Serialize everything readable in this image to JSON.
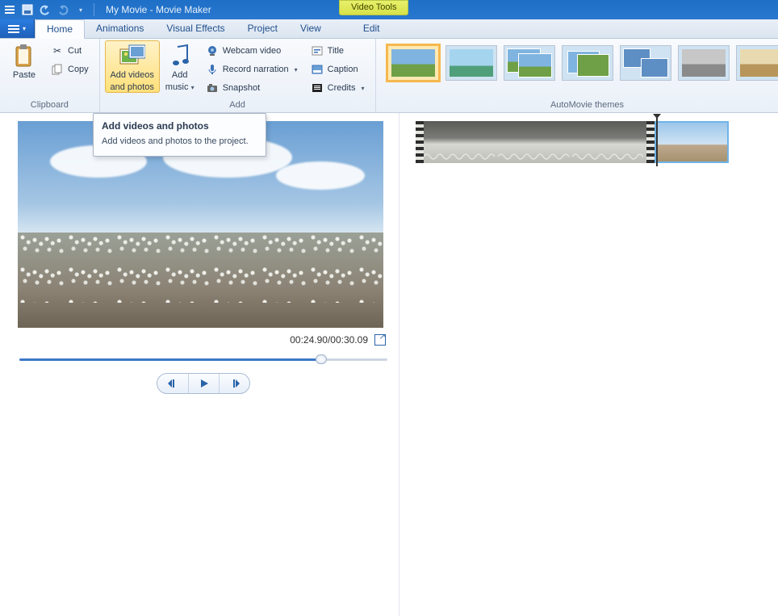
{
  "title": "My Movie - Movie Maker",
  "context_tab": "Video Tools",
  "tabs": {
    "home": "Home",
    "animations": "Animations",
    "visual_effects": "Visual Effects",
    "project": "Project",
    "view": "View",
    "edit": "Edit"
  },
  "groups": {
    "clipboard": "Clipboard",
    "add": "Add",
    "themes": "AutoMovie themes"
  },
  "clipboard": {
    "paste": "Paste",
    "cut": "Cut",
    "copy": "Copy"
  },
  "add": {
    "add_videos_line1": "Add videos",
    "add_videos_line2": "and photos",
    "add_music_line1": "Add",
    "add_music_line2": "music",
    "webcam": "Webcam video",
    "narration": "Record narration",
    "snapshot": "Snapshot",
    "title": "Title",
    "caption": "Caption",
    "credits": "Credits"
  },
  "tooltip": {
    "title": "Add videos and photos",
    "body": "Add videos and photos to the project."
  },
  "player": {
    "time": "00:24.90/00:30.09",
    "progress_pct": 82
  }
}
